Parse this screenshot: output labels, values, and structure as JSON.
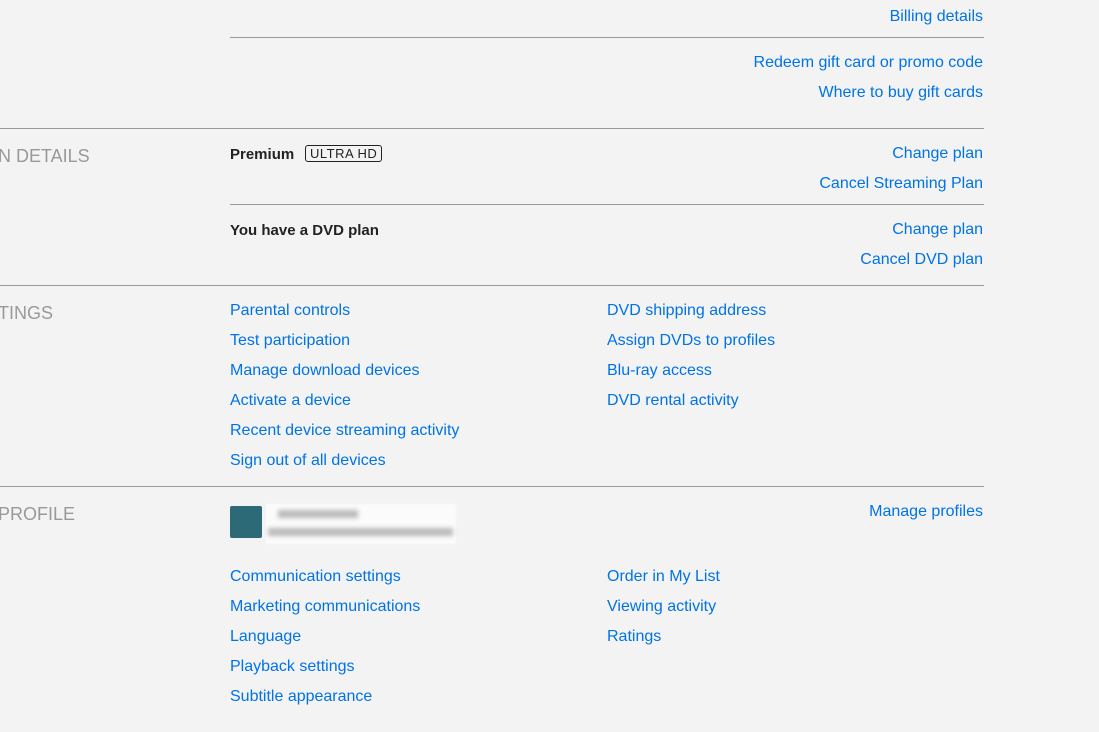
{
  "billing": {
    "billing_details": "Billing details",
    "redeem": "Redeem gift card or promo code",
    "where_to_buy": "Where to buy gift cards"
  },
  "plan": {
    "section": "N DETAILS",
    "name": "Premium",
    "badge": "ULTRA HD",
    "change_plan": "Change plan",
    "cancel_streaming": "Cancel Streaming Plan",
    "dvd_text": "You have a DVD plan",
    "dvd_change": "Change plan",
    "cancel_dvd": "Cancel DVD plan"
  },
  "settings": {
    "section": "TINGS",
    "left": [
      "Parental controls",
      "Test participation",
      "Manage download devices",
      "Activate a device",
      "Recent device streaming activity",
      "Sign out of all devices"
    ],
    "right": [
      "DVD shipping address",
      "Assign DVDs to profiles",
      "Blu-ray access",
      "DVD rental activity"
    ]
  },
  "profile": {
    "section": "PROFILE",
    "manage": "Manage profiles",
    "left": [
      "Communication settings",
      "Marketing communications",
      "Language",
      "Playback settings",
      "Subtitle appearance"
    ],
    "right": [
      "Order in My List",
      "Viewing activity",
      "Ratings"
    ]
  }
}
